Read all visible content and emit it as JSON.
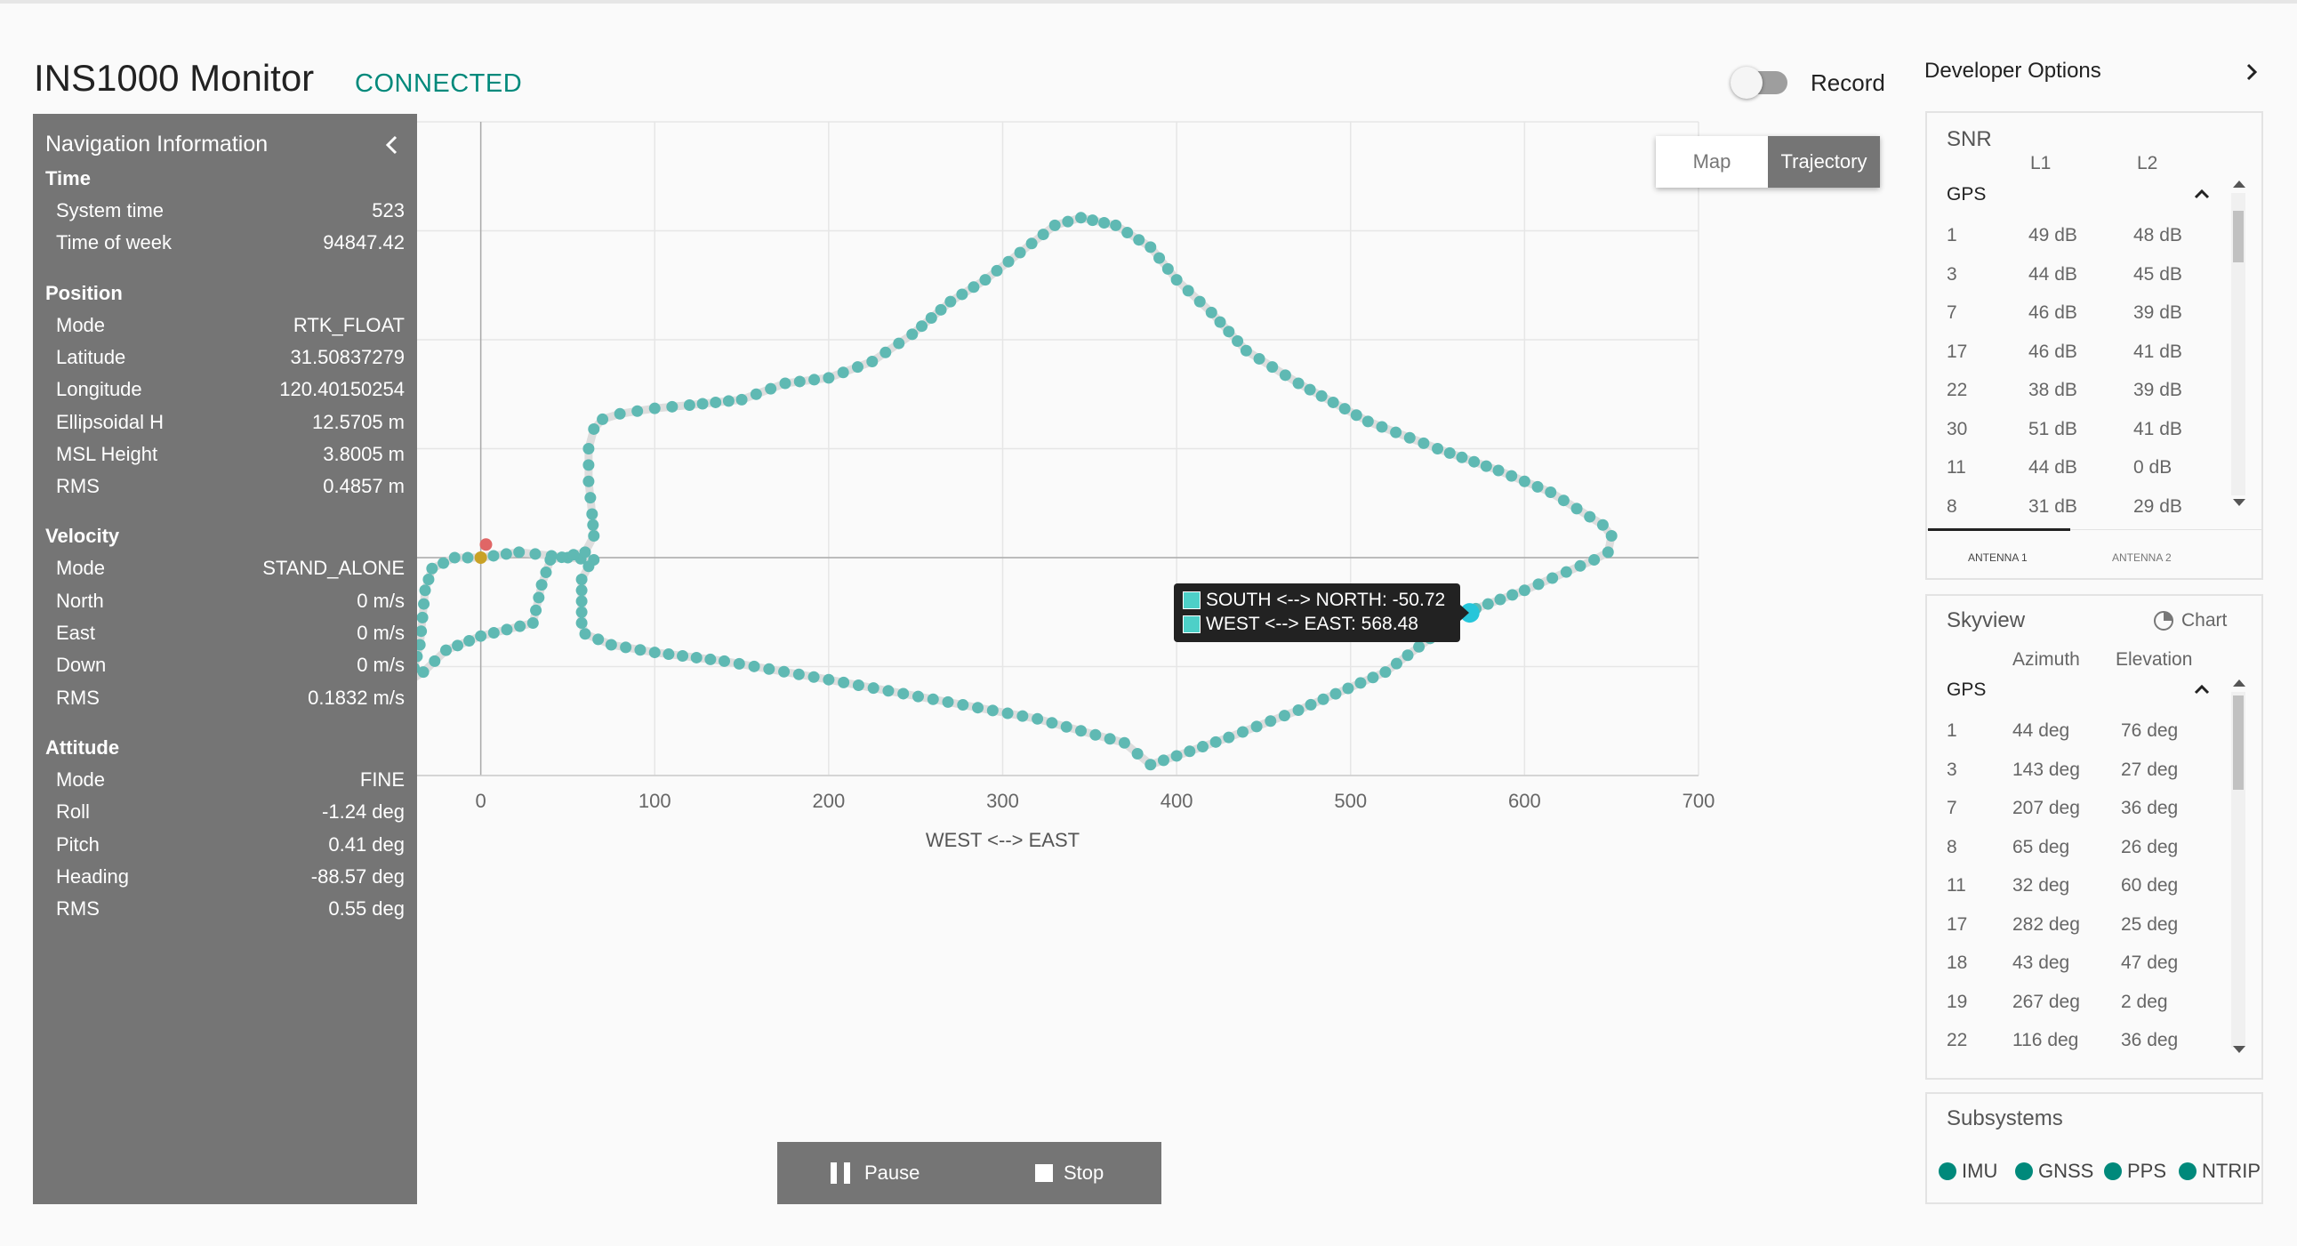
{
  "app": {
    "title": "INS1000 Monitor",
    "status": "CONNECTED",
    "record_label": "Record"
  },
  "nav": {
    "title": "Navigation Information",
    "sections": [
      {
        "name": "Time",
        "rows": [
          {
            "label": "System time",
            "value": "523"
          },
          {
            "label": "Time of week",
            "value": "94847.42"
          }
        ]
      },
      {
        "name": "Position",
        "rows": [
          {
            "label": "Mode",
            "value": "RTK_FLOAT"
          },
          {
            "label": "Latitude",
            "value": "31.50837279"
          },
          {
            "label": "Longitude",
            "value": "120.40150254"
          },
          {
            "label": "Ellipsoidal H",
            "value": "12.5705 m"
          },
          {
            "label": "MSL Height",
            "value": "3.8005 m"
          },
          {
            "label": "RMS",
            "value": "0.4857 m"
          }
        ]
      },
      {
        "name": "Velocity",
        "rows": [
          {
            "label": "Mode",
            "value": "STAND_ALONE"
          },
          {
            "label": "North",
            "value": "0 m/s"
          },
          {
            "label": "East",
            "value": "0 m/s"
          },
          {
            "label": "Down",
            "value": "0 m/s"
          },
          {
            "label": "RMS",
            "value": "0.1832 m/s"
          }
        ]
      },
      {
        "name": "Attitude",
        "rows": [
          {
            "label": "Mode",
            "value": "FINE"
          },
          {
            "label": "Roll",
            "value": "-1.24 deg"
          },
          {
            "label": "Pitch",
            "value": "0.41 deg"
          },
          {
            "label": "Heading",
            "value": "-88.57 deg"
          },
          {
            "label": "RMS",
            "value": "0.55 deg"
          }
        ]
      }
    ]
  },
  "view_toggle": {
    "map": "Map",
    "trajectory": "Trajectory",
    "selected": "Trajectory"
  },
  "chart_data": {
    "type": "scatter",
    "xlabel": "WEST <--> EAST",
    "ylabel": "SOUTH <--> NORTH",
    "xlim": [
      -100,
      700
    ],
    "ylim": [
      -200,
      400
    ],
    "xticks": [
      -100,
      0,
      100,
      200,
      300,
      400,
      500,
      600,
      700
    ],
    "yticks": [
      -200,
      -100,
      0,
      100,
      200,
      300,
      400
    ],
    "grid": true,
    "point_color": "#5fb9b3",
    "track_color": "#dddddd",
    "route": [
      [
        0,
        0
      ],
      [
        22,
        5
      ],
      [
        50,
        0
      ],
      [
        65,
        -2
      ],
      [
        62,
        -8
      ],
      [
        58,
        -20
      ],
      [
        58,
        -40
      ],
      [
        58,
        -60
      ],
      [
        60,
        -70
      ],
      [
        75,
        -80
      ],
      [
        100,
        -87
      ],
      [
        140,
        -95
      ],
      [
        200,
        -112
      ],
      [
        260,
        -130
      ],
      [
        320,
        -148
      ],
      [
        370,
        -170
      ],
      [
        385,
        -190
      ],
      [
        400,
        -182
      ],
      [
        430,
        -165
      ],
      [
        470,
        -140
      ],
      [
        520,
        -105
      ],
      [
        565,
        -51
      ],
      [
        600,
        -30
      ],
      [
        640,
        -2
      ],
      [
        648,
        5
      ],
      [
        650,
        20
      ],
      [
        645,
        30
      ],
      [
        615,
        60
      ],
      [
        585,
        80
      ],
      [
        550,
        100
      ],
      [
        510,
        125
      ],
      [
        470,
        160
      ],
      [
        440,
        190
      ],
      [
        420,
        225
      ],
      [
        400,
        255
      ],
      [
        385,
        285
      ],
      [
        365,
        305
      ],
      [
        345,
        312
      ],
      [
        330,
        305
      ],
      [
        310,
        280
      ],
      [
        290,
        255
      ],
      [
        270,
        235
      ],
      [
        248,
        205
      ],
      [
        225,
        180
      ],
      [
        200,
        165
      ],
      [
        175,
        160
      ],
      [
        150,
        145
      ],
      [
        120,
        140
      ],
      [
        100,
        137
      ],
      [
        80,
        132
      ],
      [
        70,
        127
      ],
      [
        65,
        118
      ],
      [
        62,
        100
      ],
      [
        62,
        70
      ],
      [
        64,
        40
      ],
      [
        65,
        20
      ],
      [
        60,
        5
      ],
      [
        40,
        -2
      ],
      [
        35,
        -25
      ],
      [
        30,
        -60
      ],
      [
        0,
        -72
      ],
      [
        -20,
        -85
      ],
      [
        -33,
        -105
      ],
      [
        -40,
        -112
      ],
      [
        -35,
        -80
      ],
      [
        -32,
        -30
      ],
      [
        -28,
        -10
      ],
      [
        -15,
        0
      ],
      [
        0,
        0
      ]
    ],
    "start_markers": [
      {
        "x": 3,
        "y": 12,
        "color": "#e06666"
      },
      {
        "x": 0,
        "y": 0,
        "color": "#c9a227"
      }
    ],
    "current_point": {
      "x": 568.48,
      "y": -50.72,
      "color": "#26c6da"
    },
    "tooltip": {
      "line1": "SOUTH <--> NORTH: -50.72",
      "line2": "WEST <--> EAST: 568.48"
    }
  },
  "playback": {
    "pause": "Pause",
    "stop": "Stop"
  },
  "developer": {
    "label": "Developer Options"
  },
  "snr": {
    "title": "SNR",
    "col1": "L1",
    "col2": "L2",
    "group": "GPS",
    "rows": [
      {
        "sv": "1",
        "l1": "49 dB",
        "l2": "48 dB"
      },
      {
        "sv": "3",
        "l1": "44 dB",
        "l2": "45 dB"
      },
      {
        "sv": "7",
        "l1": "46 dB",
        "l2": "39 dB"
      },
      {
        "sv": "17",
        "l1": "46 dB",
        "l2": "41 dB"
      },
      {
        "sv": "22",
        "l1": "38 dB",
        "l2": "39 dB"
      },
      {
        "sv": "30",
        "l1": "51 dB",
        "l2": "41 dB"
      },
      {
        "sv": "11",
        "l1": "44 dB",
        "l2": "0 dB"
      },
      {
        "sv": "8",
        "l1": "31 dB",
        "l2": "29 dB"
      }
    ],
    "tabs": [
      "ANTENNA 1",
      "ANTENNA 2"
    ]
  },
  "skyview": {
    "title": "Skyview",
    "chart_label": "Chart",
    "col1": "Azimuth",
    "col2": "Elevation",
    "group": "GPS",
    "rows": [
      {
        "sv": "1",
        "az": "44 deg",
        "el": "76 deg"
      },
      {
        "sv": "3",
        "az": "143 deg",
        "el": "27 deg"
      },
      {
        "sv": "7",
        "az": "207 deg",
        "el": "36 deg"
      },
      {
        "sv": "8",
        "az": "65 deg",
        "el": "26 deg"
      },
      {
        "sv": "11",
        "az": "32 deg",
        "el": "60 deg"
      },
      {
        "sv": "17",
        "az": "282 deg",
        "el": "25 deg"
      },
      {
        "sv": "18",
        "az": "43 deg",
        "el": "47 deg"
      },
      {
        "sv": "19",
        "az": "267 deg",
        "el": "2 deg"
      },
      {
        "sv": "22",
        "az": "116 deg",
        "el": "36 deg"
      }
    ]
  },
  "subsystems": {
    "title": "Subsystems",
    "items": [
      {
        "name": "IMU",
        "color": "#00897b"
      },
      {
        "name": "GNSS",
        "color": "#00897b"
      },
      {
        "name": "PPS",
        "color": "#00897b"
      },
      {
        "name": "NTRIP",
        "color": "#00897b"
      }
    ]
  }
}
